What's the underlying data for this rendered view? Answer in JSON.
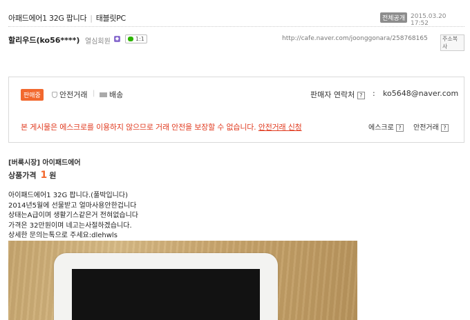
{
  "header": {
    "title": "아패드에어1 32G 팝니다",
    "category": "태블릿PC",
    "scope": "전체공개",
    "date": "2015.03.20 17:52"
  },
  "author": {
    "name": "할리우드(ko56****)",
    "level": "열심회원",
    "level_icon": "level-icon",
    "chat_count": "1:1",
    "url": "http://cafe.naver.com/joonggonara/258768165",
    "copy_url_label": "주소복사"
  },
  "trade": {
    "status": "판매중",
    "safe_trade": "안전거래",
    "delivery": "배송",
    "contact_label": "판매자 연락처",
    "help": "?",
    "colon": ":",
    "email": "ko5648@naver.com",
    "notice": "본 게시물은 에스크로를 이용하지 않으므로 거래 안전을 보장할 수 없습니다.",
    "notice_link": "안전거래 신청",
    "escrow_label": "에스크로",
    "safe_trade_label": "안전거래"
  },
  "product": {
    "tag": "[버룩시장] 아이패드에어",
    "price_label": "상품가격",
    "price_value": "1",
    "price_unit": "원"
  },
  "body": {
    "lines": [
      "아이패드에어1 32G 팝니다.(풀박입니다)",
      "2014년5월에 선물받고 얼마사용안한겁니다",
      "상태는A급이며 생활기스같은거 전혀없습니다",
      "가격은 32만원이며 네고는사절하겠습니다.",
      "상세한 문의는톡으로 주세요:dlehwls"
    ]
  },
  "colors": {
    "accent": "#f2682e",
    "notice": "#e03a1f"
  }
}
